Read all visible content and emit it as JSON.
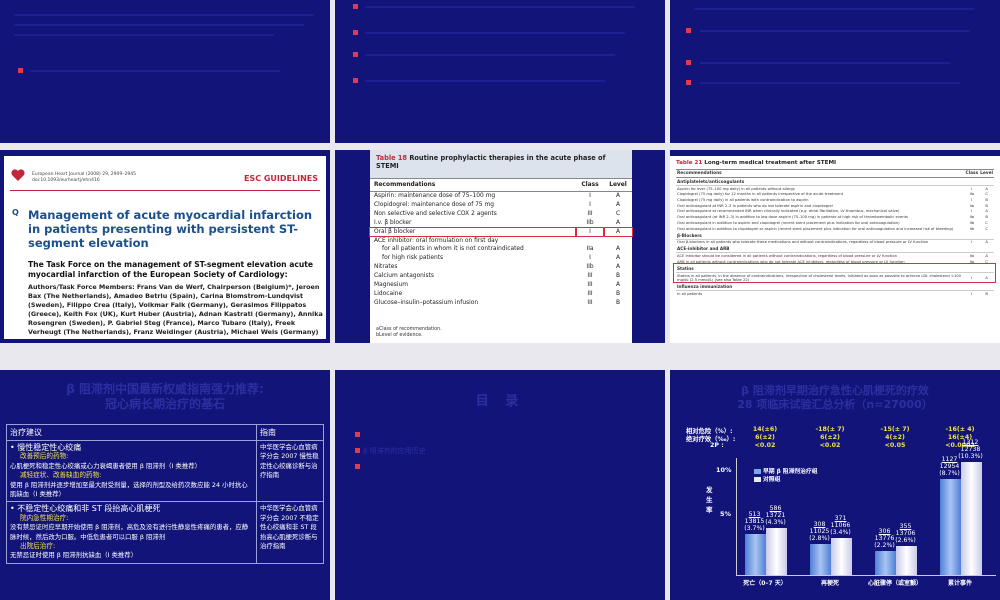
{
  "slide4": {
    "journal_line1": "European Heart Journal (2008) 29, 2909–2945",
    "journal_line2": "doi:10.1093/eurheartj/ehn416",
    "guidelines": "ESC GUIDELINES",
    "title": "Management of acute myocardial infarction in patients presenting with persistent ST-segment elevation",
    "task_force": "The Task Force on the management of ST-segment elevation acute myocardial infarction of the European Society of Cardiology:",
    "authors": "Authors/Task Force Members: Frans Van de Werf, Chairperson (Belgium)*, Jeroen Bax (The Netherlands), Amadeo Betriu (Spain), Carina Blomstrom-Lundqvist (Sweden), Filippo Crea (Italy), Volkmar Falk (Germany), Gerasimos Filippatos (Greece), Keith Fox (UK), Kurt Huber (Austria), Adnan Kastrati (Germany), Annika Rosengren (Sweden), P. Gabriel Steg (France), Marco Tubaro (Italy), Freek Verheugt (The Netherlands), Franz Weidinger (Austria), Michael Weis (Germany)"
  },
  "slide5": {
    "table_label": "Table 18",
    "table_title": "Routine prophylactic therapies in the acute phase of STEMI",
    "headers": [
      "Recommendations",
      "Class",
      "Level"
    ],
    "rows": [
      [
        "Aspirin: maintenance dose of 75–100 mg",
        "I",
        "A"
      ],
      [
        "Clopidogrel: maintenance dose of 75 mg",
        "I",
        "A"
      ],
      [
        "Non selective and selective COX 2 agents",
        "III",
        "C"
      ],
      [
        "I.v. β blocker",
        "IIb",
        "A"
      ],
      [
        "Oral β blocker",
        "I",
        "A"
      ],
      [
        "ACE inhibitor: oral formulation on first day",
        "",
        ""
      ],
      [
        "for all patients in whom it is not contraindicated",
        "IIa",
        "A"
      ],
      [
        "for high risk patients",
        "I",
        "A"
      ],
      [
        "Nitrates",
        "IIb",
        "A"
      ],
      [
        "Calcium antagonists",
        "III",
        "B"
      ],
      [
        "Magnesium",
        "III",
        "A"
      ],
      [
        "Lidocaine",
        "III",
        "B"
      ],
      [
        "Glucose–insulin–potassium infusion",
        "III",
        "B"
      ]
    ],
    "footnote1": "aClass of recommendation.",
    "footnote2": "bLevel of evidence."
  },
  "slide6": {
    "table_label": "Table 21",
    "table_title": "Long-term medical treatment after STEMI",
    "headers": [
      "Recommendations",
      "Class",
      "Level"
    ],
    "rows": [
      {
        "section": "Antiplatelets/anticoagulants"
      },
      [
        "Aspirin for ever (75–100 mg daily) in all patients without allergy",
        "I",
        "A"
      ],
      [
        "Clopidogrel (75 mg daily) for 12 months in all patients irrespective of the acute treatment",
        "IIa",
        "C"
      ],
      [
        "Clopidogrel (75 mg daily) in all patients with contraindication to aspirin",
        "I",
        "B"
      ],
      [
        "Oral anticoagulant at INR 2–3 in patients who do not tolerate aspirin and clopidogrel",
        "IIa",
        "B"
      ],
      [
        "Oral anticoagulant at recommended INR when clinically indicated (e.g. atrial fibrillation, LV thrombus, mechanical valve)",
        "I",
        "A"
      ],
      [
        "Oral anticoagulant (at INR 2–3) in addition to low dose aspirin (75–100 mg) in patients at high risk of thromboembolic events",
        "IIa",
        "B"
      ],
      [
        "Oral anticoagulant in addition to aspirin and clopidogrel (recent stent placement plus indication for oral anticoagulation)",
        "IIb",
        "C"
      ],
      [
        "Oral anticoagulant in addition to clopidogrel or aspirin (recent stent placement plus indication for oral anticoagulation and increased risk of bleeding)",
        "IIb",
        "C"
      ],
      {
        "section": "β-Blockers"
      },
      [
        "Oral β-blockers in all patients who tolerate these medications and without contraindications, regardless of blood pressure or LV function",
        "I",
        "A"
      ],
      {
        "section": "ACE-inhibitor and ARB"
      },
      [
        "ACE inhibitor should be considered in all patients without contraindications, regardless of blood pressure or LV function",
        "IIa",
        "A"
      ],
      [
        "ARB in all patients without contraindications who do not tolerate ACE inhibitors, regardless of blood pressure or LV function",
        "IIa",
        "C"
      ],
      {
        "section": "Statins"
      },
      [
        "Statins in all patients, in the absence of contraindications, irrespective of cholesterol levels, initiated as soon as possible to achieve LDL cholesterol <100 mg/dL (2.5 mmol/L) (see also Table 22)",
        "I",
        "A"
      ],
      {
        "section": "Influenza immunization"
      },
      [
        "In all patients",
        "I",
        "B"
      ]
    ]
  },
  "slide7": {
    "title_line1": "β 阻滞剂中国最新权威指南强力推荐:",
    "title_line2": "冠心病长期治疗的基石",
    "col1_header": "治疗建议",
    "col2_header": "指南",
    "row1": {
      "heading": "慢性稳定性心绞痛",
      "sub1": "改善预后的药物:",
      "text1": "心肌梗死和稳定性心绞痛或心力衰竭患者使用 β 阻滞剂（I 类推荐）",
      "sub2": "减轻症状、改善缺血的药物:",
      "text2": "使用 β 阻滞剂并逐步增加至最大耐受剂量，选择的剂型及给药次数应能 24 小时抗心肌缺血（I 类推荐）",
      "guide": "中华医学会心血管病学分会 2007 慢性稳定性心绞痛诊断与治疗指南"
    },
    "row2": {
      "heading": "不稳定性心绞痛和非 ST 段抬高心肌梗死",
      "sub1": "院内急性期治疗:",
      "text1": "没有禁忌证时应早期开始使用 β 阻滞剂，高危及没有进行性静息性疼痛的患者，应静脉时候，然后改为口服。中低危患者可以口服 β 阻滞剂",
      "sub2": "出院后治疗:",
      "text2": "无禁忌证时使用 β 阻滞剂抗缺血（I 类推荐）",
      "guide": "中华医学会心血管病学分会 2007 不稳定性心绞痛和非 ST 段抬高心肌梗死诊断与治疗指南"
    }
  },
  "slide8": {
    "title": "目  录",
    "item1": "β 阻滞剂的应用历史"
  },
  "slide9": {
    "title_line1": "β 阻滞剂早期治疗急性心肌梗死的疗效",
    "title_line2": "28 项临床试验汇总分析（n=27000）",
    "rr_label": "相对危险（%）:",
    "abs_label": "绝对疗效（‰）:",
    "p_label": "2P :",
    "legend1": "早期 β 阻滞剂治疗组",
    "legend2": "对照组",
    "ylab": "发生率",
    "colors": {
      "treat": "#7fa6e6",
      "ctrl": "#e8eaf8",
      "highlight": "#f5e24a"
    }
  },
  "chart_data": {
    "type": "bar",
    "ylabel": "发生率",
    "ylim": [
      0,
      10
    ],
    "yticks": [
      "5%",
      "10%"
    ],
    "categories": [
      "死亡（0–7 天）",
      "再梗死",
      "心脏骤停（或室颤）",
      "累计事件"
    ],
    "relative_risk": [
      "14(±6)",
      "-18(± 7)",
      "-15(± 7)",
      "-16(± 4)"
    ],
    "absolute_effect": [
      "6(±2)",
      "6(±2)",
      "4(±2)",
      "16(±4)"
    ],
    "p_values": [
      "<0.02",
      "<0.02",
      "<0.05",
      "<0.0002"
    ],
    "series": [
      {
        "name": "早期 β 阻滞剂治疗组",
        "values": [
          3.7,
          2.8,
          2.2,
          8.7
        ],
        "counts": [
          "513/13815",
          "308/11025",
          "306/13776",
          "1127/12954"
        ],
        "pct": [
          "(3.7%)",
          "(2.8%)",
          "(2.2%)",
          "(8.7%)"
        ]
      },
      {
        "name": "对照组",
        "values": [
          4.3,
          3.4,
          2.6,
          10.3
        ],
        "counts": [
          "586/13721",
          "371/11066",
          "355/13706",
          "1312/12738"
        ],
        "pct": [
          "(4.3%)",
          "(3.4%)",
          "(2.6%)",
          "(10.3%)"
        ]
      }
    ]
  }
}
